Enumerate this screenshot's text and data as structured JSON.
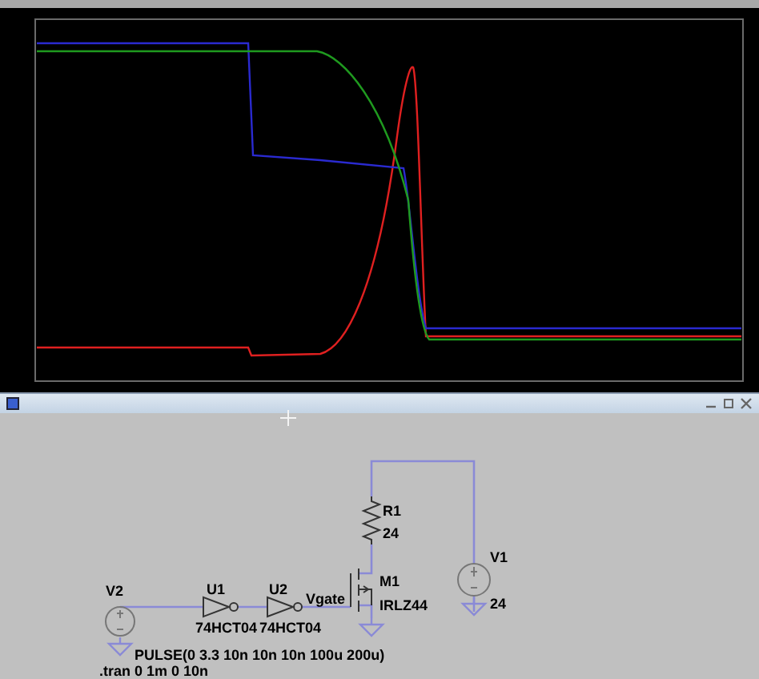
{
  "plot": {
    "traces": [
      {
        "color": "#e02020"
      },
      {
        "color": "#2a2ad0"
      },
      {
        "color": "#1f9a1f"
      }
    ]
  },
  "schematic": {
    "parts": [
      {
        "kind": "resistor",
        "ref": "R1",
        "value": "24"
      },
      {
        "kind": "nmos",
        "ref": "M1",
        "part": "IRLZ44"
      },
      {
        "kind": "source",
        "ref": "V1",
        "value": "24"
      },
      {
        "kind": "source",
        "ref": "V2",
        "value": "PULSE(0 3.3 10n 10n 10n 100u 200u)"
      },
      {
        "kind": "inverter",
        "ref": "U1",
        "part": "74HCT04"
      },
      {
        "kind": "inverter",
        "ref": "U2",
        "part": "74HCT04"
      },
      {
        "kind": "net_label",
        "name": "Vgate"
      }
    ],
    "directives": [
      ".tran 0 1m 0 10n"
    ]
  }
}
